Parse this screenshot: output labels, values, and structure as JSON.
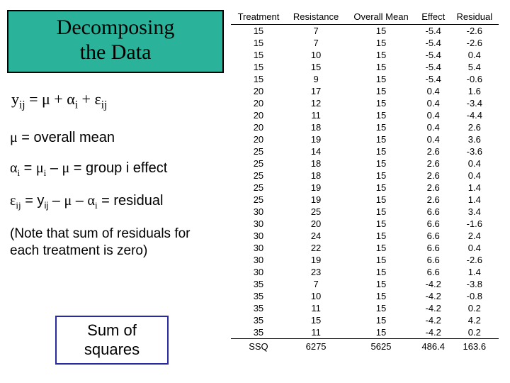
{
  "title": {
    "line1": "Decomposing",
    "line2": "the Data"
  },
  "equation": {
    "lhs_y": "y",
    "lhs_sub": "ij",
    "eq": " = ",
    "mu": "μ",
    "plus1": " + ",
    "alpha": "α",
    "alpha_sub": "i",
    "plus2": " + ",
    "eps": "ε",
    "eps_sub": "ij"
  },
  "defs": {
    "line1_pre": "μ",
    "line1_rest": " = overall mean",
    "line2_a": "α",
    "line2_a_sub": "i",
    "line2_mid1": " = ",
    "line2_mu": "μ",
    "line2_mu_sub": "i",
    "line2_minus": " – ",
    "line2_mu2": "μ",
    "line2_rest": " = group i effect",
    "line3_e": "ε",
    "line3_e_sub": "ij",
    "line3_eq": " = y",
    "line3_y_sub": "ij",
    "line3_minus1": " – ",
    "line3_mu": "μ",
    "line3_minus2": " – ",
    "line3_a": "α",
    "line3_a_sub": "i",
    "line3_rest": " = residual"
  },
  "note": {
    "line1": "(Note that sum of residuals for",
    "line2": "each treatment is zero)"
  },
  "ssq_box": {
    "line1": "Sum of",
    "line2": "squares"
  },
  "table": {
    "headers": [
      "Treatment",
      "Resistance",
      "Overall Mean",
      "Effect",
      "Residual"
    ],
    "ssq_label": "SSQ",
    "ssq": [
      "6275",
      "5625",
      "486.4",
      "163.6"
    ]
  },
  "chart_data": {
    "type": "table",
    "title": "Decomposing the Data",
    "columns": [
      "Treatment",
      "Resistance",
      "Overall Mean",
      "Effect",
      "Residual"
    ],
    "rows": [
      [
        15,
        7,
        15,
        -5.4,
        -2.6
      ],
      [
        15,
        7,
        15,
        -5.4,
        -2.6
      ],
      [
        15,
        10,
        15,
        -5.4,
        0.4
      ],
      [
        15,
        15,
        15,
        -5.4,
        5.4
      ],
      [
        15,
        9,
        15,
        -5.4,
        -0.6
      ],
      [
        20,
        17,
        15,
        0.4,
        1.6
      ],
      [
        20,
        12,
        15,
        0.4,
        -3.4
      ],
      [
        20,
        11,
        15,
        0.4,
        -4.4
      ],
      [
        20,
        18,
        15,
        0.4,
        2.6
      ],
      [
        20,
        19,
        15,
        0.4,
        3.6
      ],
      [
        25,
        14,
        15,
        2.6,
        -3.6
      ],
      [
        25,
        18,
        15,
        2.6,
        0.4
      ],
      [
        25,
        18,
        15,
        2.6,
        0.4
      ],
      [
        25,
        19,
        15,
        2.6,
        1.4
      ],
      [
        25,
        19,
        15,
        2.6,
        1.4
      ],
      [
        30,
        25,
        15,
        6.6,
        3.4
      ],
      [
        30,
        20,
        15,
        6.6,
        -1.6
      ],
      [
        30,
        24,
        15,
        6.6,
        2.4
      ],
      [
        30,
        22,
        15,
        6.6,
        0.4
      ],
      [
        30,
        19,
        15,
        6.6,
        -2.6
      ],
      [
        30,
        23,
        15,
        6.6,
        1.4
      ],
      [
        35,
        7,
        15,
        -4.2,
        -3.8
      ],
      [
        35,
        10,
        15,
        -4.2,
        -0.8
      ],
      [
        35,
        11,
        15,
        -4.2,
        0.2
      ],
      [
        35,
        15,
        15,
        -4.2,
        4.2
      ],
      [
        35,
        11,
        15,
        -4.2,
        0.2
      ]
    ],
    "ssq": {
      "Resistance": 6275,
      "Overall Mean": 5625,
      "Effect": 486.4,
      "Residual": 163.6
    }
  }
}
